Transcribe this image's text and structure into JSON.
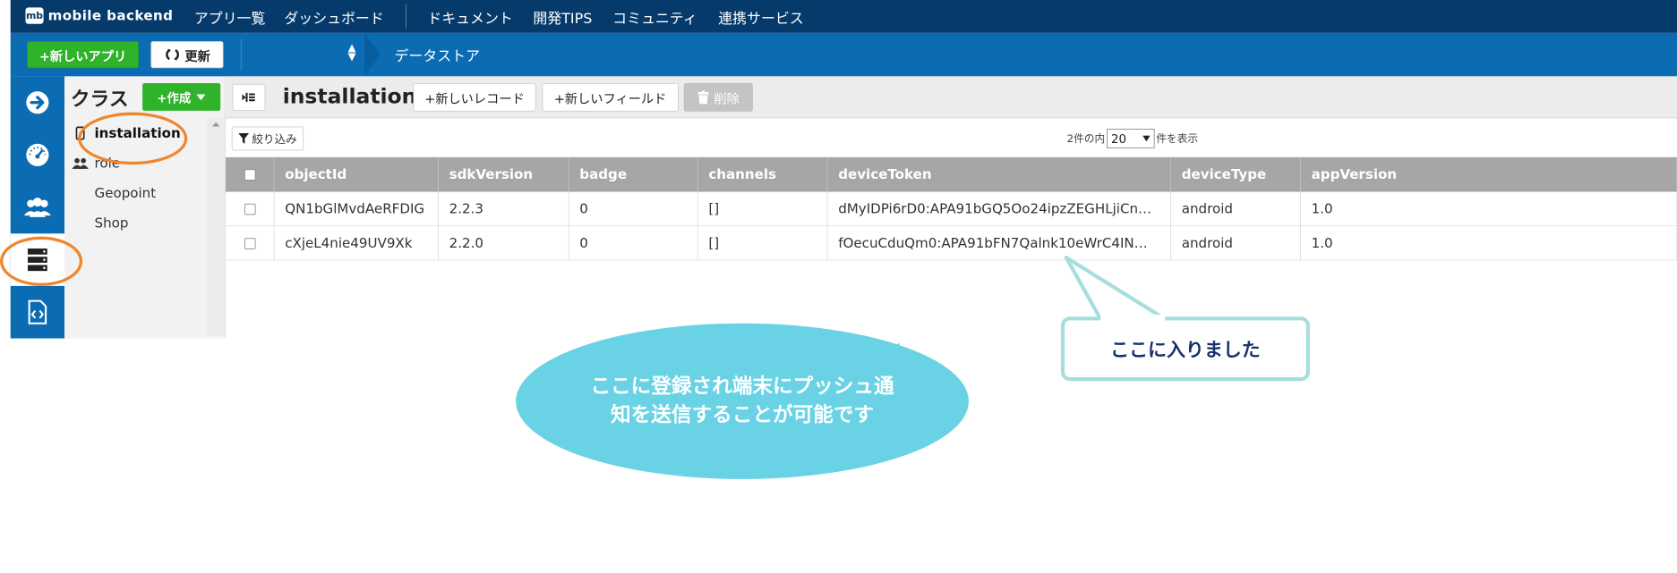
{
  "brand": {
    "logo_mark": "mb",
    "name": "mobile backend",
    "accent": "#063a6b",
    "blue": "#0b6cb3",
    "green": "#2fb32b"
  },
  "topnav": {
    "items": [
      "アプリ一覧",
      "ダッシュボード",
      "ドキュメント",
      "開発TIPS",
      "コミュニティ",
      "連携サービス"
    ]
  },
  "subbar": {
    "new_app_label": "+新しいアプリ",
    "refresh_label": "更新",
    "breadcrumb": "データストア"
  },
  "rail": {
    "icons": [
      "arrow-right-icon",
      "dashboard-gauge-icon",
      "users-icon",
      "datastore-icon",
      "code-icon"
    ],
    "active_index": 3
  },
  "classes": {
    "title": "クラス",
    "create_label": "+作成",
    "items": [
      {
        "label": "installation",
        "icon": "device-icon"
      },
      {
        "label": "role",
        "icon": "users-icon"
      },
      {
        "label": "Geopoint",
        "icon": ""
      },
      {
        "label": "Shop",
        "icon": ""
      }
    ],
    "selected_index": 0
  },
  "main": {
    "table_title": "installation",
    "new_record_label": "+新しいレコード",
    "new_field_label": "+新しいフィールド",
    "delete_label": "削除",
    "filter_label": "絞り込み",
    "paging": {
      "prefix": "2件の内",
      "page_size": "20",
      "suffix": "件を表示"
    },
    "columns": [
      "objectId",
      "sdkVersion",
      "badge",
      "channels",
      "deviceToken",
      "deviceType",
      "appVersion"
    ],
    "rows": [
      [
        "QN1bGlMvdAeRFDIG",
        "2.2.3",
        "0",
        "[]",
        "dMyIDPi6rD0:APA91bGQ5Oo24ipzZEGHLjiCn…",
        "android",
        "1.0"
      ],
      [
        "cXjeL4nie49UV9Xk",
        "2.2.0",
        "0",
        "[]",
        "fOecuCduQm0:APA91bFN7Qalnk10eWrC4IN…",
        "android",
        "1.0"
      ]
    ]
  },
  "annotations": {
    "box_text": "ここに入りました",
    "bubble_text": "ここに登録され端末にプッシュ通知を送信することが可能です",
    "ring_color": "#f0862b",
    "bubble_color": "#69d3e5",
    "box_border_color": "#a6dede"
  }
}
